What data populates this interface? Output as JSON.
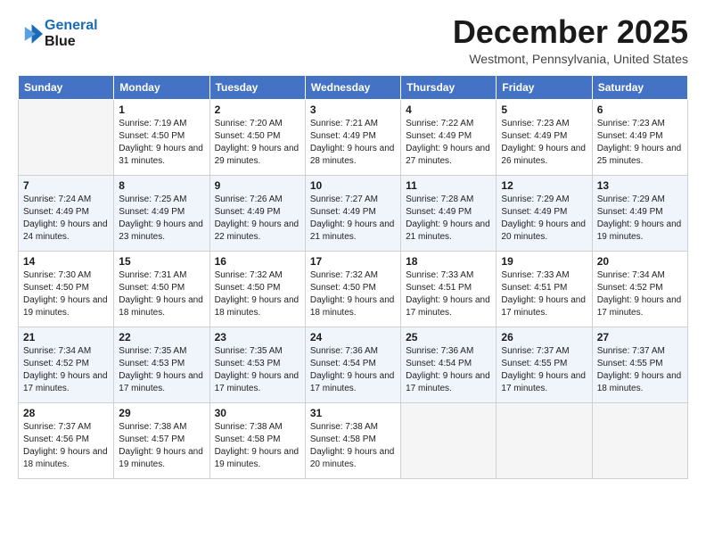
{
  "logo": {
    "line1": "General",
    "line2": "Blue"
  },
  "title": "December 2025",
  "location": "Westmont, Pennsylvania, United States",
  "days_header": [
    "Sunday",
    "Monday",
    "Tuesday",
    "Wednesday",
    "Thursday",
    "Friday",
    "Saturday"
  ],
  "weeks": [
    [
      {
        "num": "",
        "empty": true
      },
      {
        "num": "1",
        "sunrise": "7:19 AM",
        "sunset": "4:50 PM",
        "daylight": "9 hours and 31 minutes."
      },
      {
        "num": "2",
        "sunrise": "7:20 AM",
        "sunset": "4:50 PM",
        "daylight": "9 hours and 29 minutes."
      },
      {
        "num": "3",
        "sunrise": "7:21 AM",
        "sunset": "4:49 PM",
        "daylight": "9 hours and 28 minutes."
      },
      {
        "num": "4",
        "sunrise": "7:22 AM",
        "sunset": "4:49 PM",
        "daylight": "9 hours and 27 minutes."
      },
      {
        "num": "5",
        "sunrise": "7:23 AM",
        "sunset": "4:49 PM",
        "daylight": "9 hours and 26 minutes."
      },
      {
        "num": "6",
        "sunrise": "7:23 AM",
        "sunset": "4:49 PM",
        "daylight": "9 hours and 25 minutes."
      }
    ],
    [
      {
        "num": "7",
        "sunrise": "7:24 AM",
        "sunset": "4:49 PM",
        "daylight": "9 hours and 24 minutes."
      },
      {
        "num": "8",
        "sunrise": "7:25 AM",
        "sunset": "4:49 PM",
        "daylight": "9 hours and 23 minutes."
      },
      {
        "num": "9",
        "sunrise": "7:26 AM",
        "sunset": "4:49 PM",
        "daylight": "9 hours and 22 minutes."
      },
      {
        "num": "10",
        "sunrise": "7:27 AM",
        "sunset": "4:49 PM",
        "daylight": "9 hours and 21 minutes."
      },
      {
        "num": "11",
        "sunrise": "7:28 AM",
        "sunset": "4:49 PM",
        "daylight": "9 hours and 21 minutes."
      },
      {
        "num": "12",
        "sunrise": "7:29 AM",
        "sunset": "4:49 PM",
        "daylight": "9 hours and 20 minutes."
      },
      {
        "num": "13",
        "sunrise": "7:29 AM",
        "sunset": "4:49 PM",
        "daylight": "9 hours and 19 minutes."
      }
    ],
    [
      {
        "num": "14",
        "sunrise": "7:30 AM",
        "sunset": "4:50 PM",
        "daylight": "9 hours and 19 minutes."
      },
      {
        "num": "15",
        "sunrise": "7:31 AM",
        "sunset": "4:50 PM",
        "daylight": "9 hours and 18 minutes."
      },
      {
        "num": "16",
        "sunrise": "7:32 AM",
        "sunset": "4:50 PM",
        "daylight": "9 hours and 18 minutes."
      },
      {
        "num": "17",
        "sunrise": "7:32 AM",
        "sunset": "4:50 PM",
        "daylight": "9 hours and 18 minutes."
      },
      {
        "num": "18",
        "sunrise": "7:33 AM",
        "sunset": "4:51 PM",
        "daylight": "9 hours and 17 minutes."
      },
      {
        "num": "19",
        "sunrise": "7:33 AM",
        "sunset": "4:51 PM",
        "daylight": "9 hours and 17 minutes."
      },
      {
        "num": "20",
        "sunrise": "7:34 AM",
        "sunset": "4:52 PM",
        "daylight": "9 hours and 17 minutes."
      }
    ],
    [
      {
        "num": "21",
        "sunrise": "7:34 AM",
        "sunset": "4:52 PM",
        "daylight": "9 hours and 17 minutes."
      },
      {
        "num": "22",
        "sunrise": "7:35 AM",
        "sunset": "4:53 PM",
        "daylight": "9 hours and 17 minutes."
      },
      {
        "num": "23",
        "sunrise": "7:35 AM",
        "sunset": "4:53 PM",
        "daylight": "9 hours and 17 minutes."
      },
      {
        "num": "24",
        "sunrise": "7:36 AM",
        "sunset": "4:54 PM",
        "daylight": "9 hours and 17 minutes."
      },
      {
        "num": "25",
        "sunrise": "7:36 AM",
        "sunset": "4:54 PM",
        "daylight": "9 hours and 17 minutes."
      },
      {
        "num": "26",
        "sunrise": "7:37 AM",
        "sunset": "4:55 PM",
        "daylight": "9 hours and 17 minutes."
      },
      {
        "num": "27",
        "sunrise": "7:37 AM",
        "sunset": "4:55 PM",
        "daylight": "9 hours and 18 minutes."
      }
    ],
    [
      {
        "num": "28",
        "sunrise": "7:37 AM",
        "sunset": "4:56 PM",
        "daylight": "9 hours and 18 minutes."
      },
      {
        "num": "29",
        "sunrise": "7:38 AM",
        "sunset": "4:57 PM",
        "daylight": "9 hours and 19 minutes."
      },
      {
        "num": "30",
        "sunrise": "7:38 AM",
        "sunset": "4:58 PM",
        "daylight": "9 hours and 19 minutes."
      },
      {
        "num": "31",
        "sunrise": "7:38 AM",
        "sunset": "4:58 PM",
        "daylight": "9 hours and 20 minutes."
      },
      {
        "num": "",
        "empty": true
      },
      {
        "num": "",
        "empty": true
      },
      {
        "num": "",
        "empty": true
      }
    ]
  ],
  "labels": {
    "sunrise_prefix": "Sunrise: ",
    "sunset_prefix": "Sunset: ",
    "daylight_prefix": "Daylight: "
  }
}
